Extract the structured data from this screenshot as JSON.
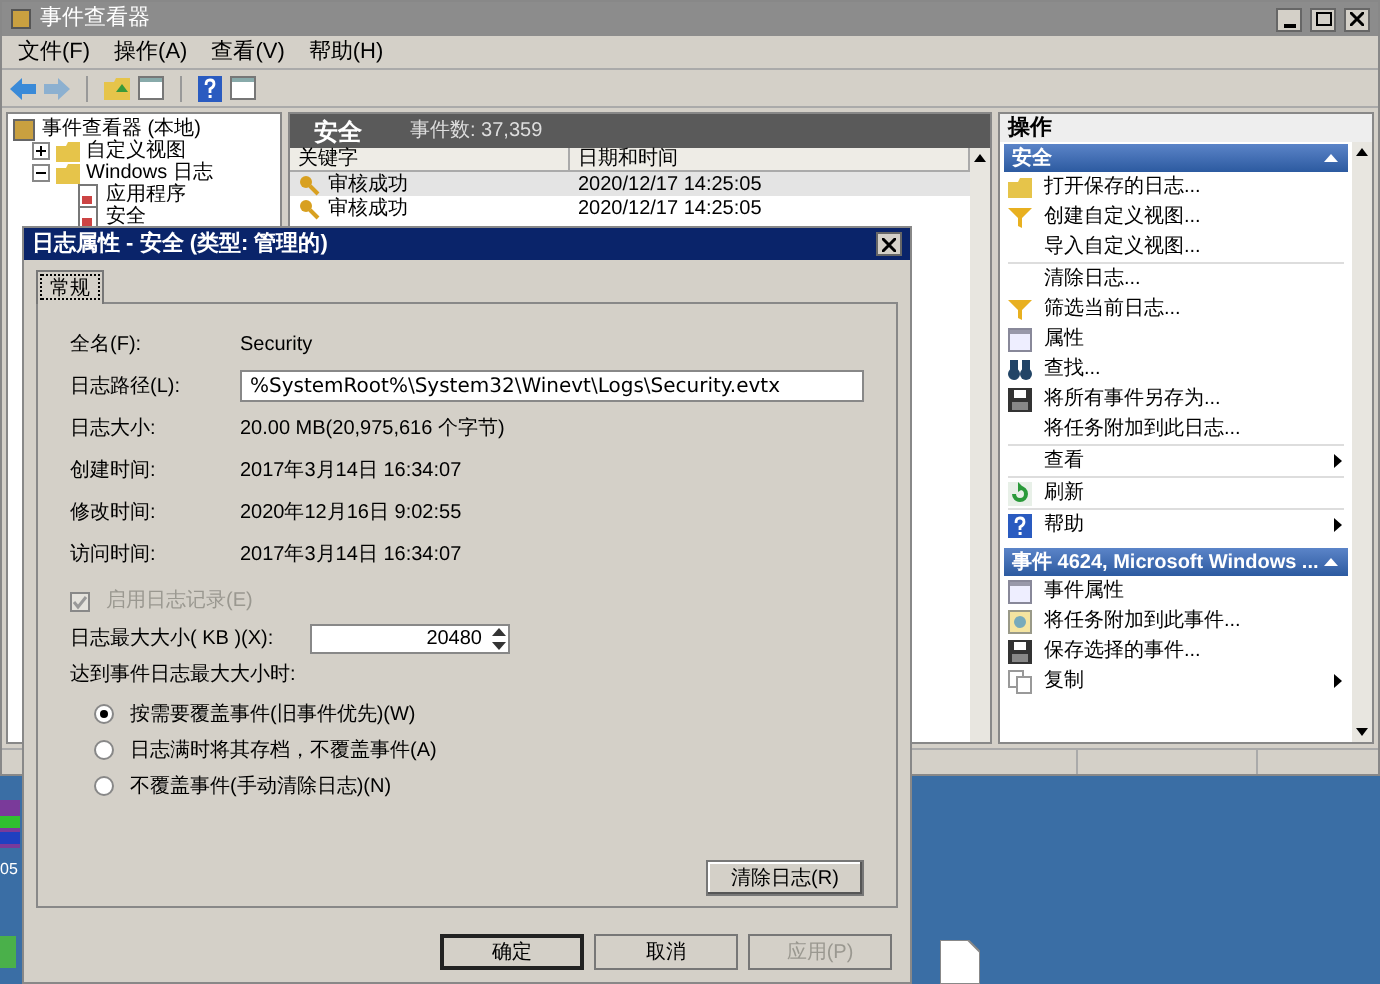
{
  "main_window": {
    "title": "事件查看器",
    "menu": [
      "文件(F)",
      "操作(A)",
      "查看(V)",
      "帮助(H)"
    ],
    "tree": {
      "label": "事件查看器 (本地)",
      "children": [
        {
          "label": "自定义视图",
          "expanded": false
        },
        {
          "label": "Windows 日志",
          "expanded": true,
          "children": [
            {
              "label": "应用程序"
            },
            {
              "label": "安全"
            }
          ]
        }
      ]
    },
    "log_header": {
      "title": "安全",
      "event_count": "事件数: 37,359"
    },
    "table": {
      "columns": [
        "关键字",
        "日期和时间"
      ],
      "rows": [
        {
          "keyword": "审核成功",
          "datetime": "2020/12/17 14:25:05"
        },
        {
          "keyword": "审核成功",
          "datetime": "2020/12/17 14:25:05"
        }
      ]
    },
    "actions": {
      "title": "操作",
      "sections": [
        {
          "title": "安全",
          "expanded": true,
          "groups": [
            [
              {
                "kind": "folder",
                "label": "打开保存的日志...",
                "submenu": false
              },
              {
                "kind": "funnel",
                "label": "创建自定义视图...",
                "submenu": false
              },
              {
                "kind": "none",
                "label": "导入自定义视图...",
                "submenu": false
              }
            ],
            [
              {
                "kind": "none",
                "label": "清除日志...",
                "submenu": false
              },
              {
                "kind": "funnel",
                "label": "筛选当前日志...",
                "submenu": false
              },
              {
                "kind": "sheet",
                "label": "属性",
                "submenu": false
              },
              {
                "kind": "binoculars",
                "label": "查找...",
                "submenu": false
              },
              {
                "kind": "floppy",
                "label": "将所有事件另存为...",
                "submenu": false
              },
              {
                "kind": "none",
                "label": "将任务附加到此日志...",
                "submenu": false
              }
            ],
            [
              {
                "kind": "none",
                "label": "查看",
                "submenu": true
              }
            ],
            [
              {
                "kind": "refresh",
                "label": "刷新",
                "submenu": false
              }
            ],
            [
              {
                "kind": "help",
                "label": "帮助",
                "submenu": true
              }
            ]
          ]
        },
        {
          "title": "事件 4624, Microsoft Windows ...",
          "expanded": true,
          "groups": [
            [
              {
                "kind": "sheet",
                "label": "事件属性",
                "submenu": false
              },
              {
                "kind": "task",
                "label": "将任务附加到此事件...",
                "submenu": false
              },
              {
                "kind": "floppy",
                "label": "保存选择的事件...",
                "submenu": false
              },
              {
                "kind": "copy",
                "label": "复制",
                "submenu": true
              }
            ]
          ]
        }
      ]
    }
  },
  "dialog": {
    "title": "日志属性 - 安全 (类型: 管理的)",
    "tabs": [
      {
        "label": "常规",
        "selected": true
      }
    ],
    "fields": [
      {
        "kind": "text",
        "label": "全名(F):",
        "value": "Security"
      },
      {
        "kind": "input",
        "label": "日志路径(L):",
        "value": "%SystemRoot%\\System32\\Winevt\\Logs\\Security.evtx"
      },
      {
        "kind": "text",
        "label": "日志大小:",
        "value": "20.00 MB(20,975,616 个字节)"
      },
      {
        "kind": "text",
        "label": "创建时间:",
        "value": "2017年3月14日 16:34:07"
      },
      {
        "kind": "text",
        "label": "修改时间:",
        "value": "2020年12月16日 9:02:55"
      },
      {
        "kind": "text",
        "label": "访问时间:",
        "value": "2017年3月14日 16:34:07"
      }
    ],
    "enable_logging": {
      "label": "启用日志记录(E)",
      "checked": true,
      "disabled": true
    },
    "max_size": {
      "label": "日志最大大小( KB )(X):",
      "value": "20480"
    },
    "on_full": {
      "label": "达到事件日志最大大小时:",
      "options": [
        {
          "label": "按需要覆盖事件(旧事件优先)(W)",
          "selected": true
        },
        {
          "label": "日志满时将其存档，不覆盖事件(A)",
          "selected": false
        },
        {
          "label": "不覆盖事件(手动清除日志)(N)",
          "selected": false
        }
      ]
    },
    "clear_button": "清除日志(R)",
    "buttons": [
      {
        "label": "确定",
        "default": true,
        "disabled": false
      },
      {
        "label": "取消",
        "default": false,
        "disabled": false
      },
      {
        "label": "应用(P)",
        "default": false,
        "disabled": true
      }
    ]
  },
  "desktop": {
    "icon_label": "05"
  }
}
